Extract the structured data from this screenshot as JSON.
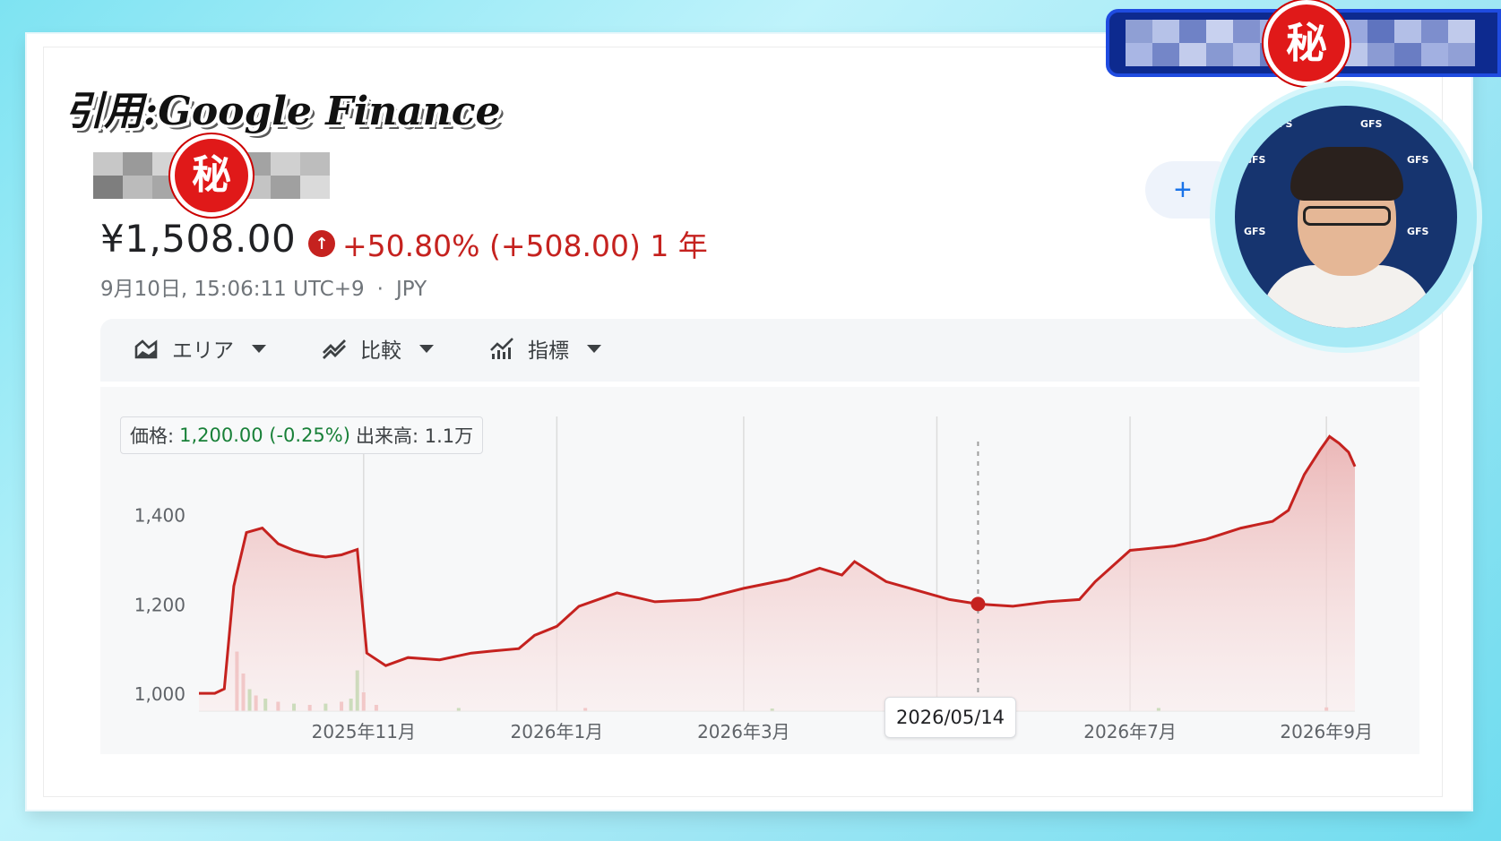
{
  "caption": "引用:Google Finance",
  "secret_mark": "秘",
  "stock": {
    "price": "¥1,508.00",
    "change": "+50.80% (+508.00) 1 年",
    "timestamp": "9月10日, 15:06:11 UTC+9",
    "separator": "·",
    "currency": "JPY"
  },
  "add_button": "+",
  "toolbar": {
    "area_label": "エリア",
    "compare_label": "比較",
    "indicator_label": "指標"
  },
  "tooltip": {
    "price_label": "価格:",
    "price_value": "1,200.00 (-0.25%)",
    "volume_label": "出来高: 1.1万"
  },
  "hover_date": "2026/05/14",
  "webcam_logo": "GFS",
  "colors": {
    "line": "#c5221f",
    "area": "#f3c4c4",
    "grid": "#dcdcdc",
    "volume_red": "#e8a6a6",
    "volume_green": "#9ccf8e"
  },
  "chart_data": {
    "type": "area",
    "title": "",
    "xlabel": "",
    "ylabel": "",
    "ylim": [
      960,
      1620
    ],
    "yticks": [
      1000,
      1200,
      1400
    ],
    "ytick_labels": [
      "1,400",
      "1,200",
      "1,000"
    ],
    "x_date_range": [
      "2025-09-10",
      "2026-09-10"
    ],
    "xticks": [
      {
        "date": "2025-11-01",
        "label": "2025年11月"
      },
      {
        "date": "2026-01-01",
        "label": "2026年1月"
      },
      {
        "date": "2026-03-01",
        "label": "2026年3月"
      },
      {
        "date": "2026-07-01",
        "label": "2026年7月"
      },
      {
        "date": "2026-09-01",
        "label": "2026年9月"
      }
    ],
    "marker": {
      "date": "2026-05-14",
      "value": 1200
    },
    "series": [
      {
        "points": [
          [
            "2025-09-10",
            1000
          ],
          [
            "2025-09-15",
            1000
          ],
          [
            "2025-09-18",
            1010
          ],
          [
            "2025-09-21",
            1240
          ],
          [
            "2025-09-25",
            1360
          ],
          [
            "2025-09-30",
            1370
          ],
          [
            "2025-10-05",
            1335
          ],
          [
            "2025-10-10",
            1320
          ],
          [
            "2025-10-15",
            1310
          ],
          [
            "2025-10-20",
            1305
          ],
          [
            "2025-10-25",
            1310
          ],
          [
            "2025-10-30",
            1322
          ],
          [
            "2025-11-02",
            1090
          ],
          [
            "2025-11-08",
            1062
          ],
          [
            "2025-11-15",
            1080
          ],
          [
            "2025-11-25",
            1075
          ],
          [
            "2025-12-05",
            1090
          ],
          [
            "2025-12-12",
            1095
          ],
          [
            "2025-12-20",
            1100
          ],
          [
            "2025-12-25",
            1130
          ],
          [
            "2026-01-01",
            1150
          ],
          [
            "2026-01-08",
            1195
          ],
          [
            "2026-01-20",
            1225
          ],
          [
            "2026-02-01",
            1205
          ],
          [
            "2026-02-15",
            1210
          ],
          [
            "2026-03-01",
            1235
          ],
          [
            "2026-03-15",
            1255
          ],
          [
            "2026-03-25",
            1280
          ],
          [
            "2026-04-01",
            1265
          ],
          [
            "2026-04-05",
            1295
          ],
          [
            "2026-04-15",
            1250
          ],
          [
            "2026-04-25",
            1230
          ],
          [
            "2026-05-05",
            1210
          ],
          [
            "2026-05-14",
            1200
          ],
          [
            "2026-05-25",
            1195
          ],
          [
            "2026-06-05",
            1205
          ],
          [
            "2026-06-15",
            1210
          ],
          [
            "2026-06-20",
            1250
          ],
          [
            "2026-07-01",
            1320
          ],
          [
            "2026-07-15",
            1330
          ],
          [
            "2026-07-25",
            1345
          ],
          [
            "2026-08-05",
            1370
          ],
          [
            "2026-08-15",
            1385
          ],
          [
            "2026-08-20",
            1410
          ],
          [
            "2026-08-25",
            1490
          ],
          [
            "2026-08-30",
            1545
          ],
          [
            "2026-09-02",
            1575
          ],
          [
            "2026-09-05",
            1560
          ],
          [
            "2026-09-08",
            1540
          ],
          [
            "2026-09-10",
            1508
          ]
        ]
      }
    ],
    "volume": [
      [
        "2025-09-22",
        0.95,
        "red"
      ],
      [
        "2025-09-24",
        0.6,
        "red"
      ],
      [
        "2025-09-26",
        0.35,
        "green"
      ],
      [
        "2025-09-28",
        0.25,
        "red"
      ],
      [
        "2025-10-01",
        0.2,
        "green"
      ],
      [
        "2025-10-05",
        0.15,
        "red"
      ],
      [
        "2025-10-10",
        0.12,
        "green"
      ],
      [
        "2025-10-15",
        0.1,
        "red"
      ],
      [
        "2025-10-20",
        0.12,
        "green"
      ],
      [
        "2025-10-25",
        0.15,
        "red"
      ],
      [
        "2025-10-28",
        0.2,
        "green"
      ],
      [
        "2025-10-30",
        0.65,
        "green"
      ],
      [
        "2025-11-01",
        0.3,
        "red"
      ],
      [
        "2025-11-05",
        0.1,
        "red"
      ],
      [
        "2025-12-01",
        0.05,
        "green"
      ],
      [
        "2026-01-10",
        0.05,
        "red"
      ],
      [
        "2026-03-10",
        0.04,
        "green"
      ],
      [
        "2026-05-10",
        0.04,
        "red"
      ],
      [
        "2026-07-10",
        0.05,
        "green"
      ],
      [
        "2026-09-01",
        0.06,
        "red"
      ]
    ]
  }
}
